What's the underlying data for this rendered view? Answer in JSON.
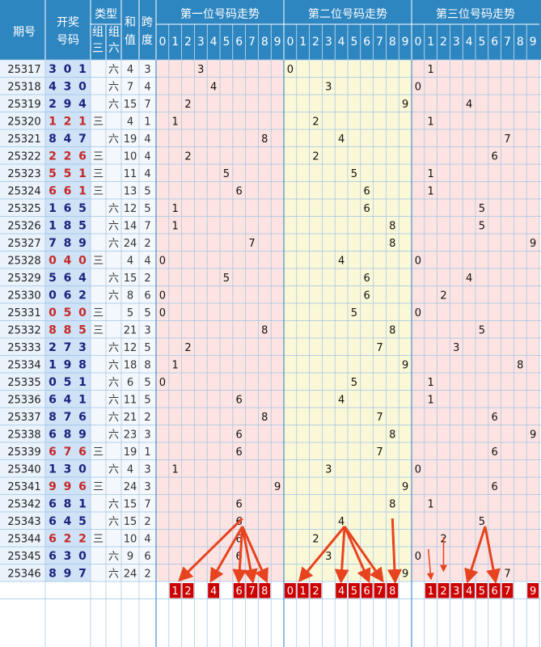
{
  "header": {
    "period_label": "期号",
    "draw_label_1": "开奖",
    "draw_label_2": "号码",
    "type_label": "类型",
    "group3_label_1": "组",
    "group3_label_2": "三",
    "group6_label_1": "组",
    "group6_label_2": "六",
    "sum_label_1": "和",
    "sum_label_2": "值",
    "span_label_1": "跨",
    "span_label_2": "度",
    "pos1_title": "第一位号码走势",
    "pos2_title": "第二位号码走势",
    "pos3_title": "第三位号码走势",
    "digits": [
      "0",
      "1",
      "2",
      "3",
      "4",
      "5",
      "6",
      "7",
      "8",
      "9"
    ],
    "group3_mark": "三",
    "group6_mark": "六"
  },
  "chart_data": {
    "type": "table",
    "rows": [
      {
        "period": "25317",
        "digits": [
          3,
          0,
          1
        ],
        "type": "六",
        "sum": 4,
        "span": 3
      },
      {
        "period": "25318",
        "digits": [
          4,
          3,
          0
        ],
        "type": "六",
        "sum": 7,
        "span": 4
      },
      {
        "period": "25319",
        "digits": [
          2,
          9,
          4
        ],
        "type": "六",
        "sum": 15,
        "span": 7
      },
      {
        "period": "25320",
        "digits": [
          1,
          2,
          1
        ],
        "type": "三",
        "sum": 4,
        "span": 1
      },
      {
        "period": "25321",
        "digits": [
          8,
          4,
          7
        ],
        "type": "六",
        "sum": 19,
        "span": 4
      },
      {
        "period": "25322",
        "digits": [
          2,
          2,
          6
        ],
        "type": "三",
        "sum": 10,
        "span": 4
      },
      {
        "period": "25323",
        "digits": [
          5,
          5,
          1
        ],
        "type": "三",
        "sum": 11,
        "span": 4
      },
      {
        "period": "25324",
        "digits": [
          6,
          6,
          1
        ],
        "type": "三",
        "sum": 13,
        "span": 5
      },
      {
        "period": "25325",
        "digits": [
          1,
          6,
          5
        ],
        "type": "六",
        "sum": 12,
        "span": 5
      },
      {
        "period": "25326",
        "digits": [
          1,
          8,
          5
        ],
        "type": "六",
        "sum": 14,
        "span": 7
      },
      {
        "period": "25327",
        "digits": [
          7,
          8,
          9
        ],
        "type": "六",
        "sum": 24,
        "span": 2
      },
      {
        "period": "25328",
        "digits": [
          0,
          4,
          0
        ],
        "type": "三",
        "sum": 4,
        "span": 4
      },
      {
        "period": "25329",
        "digits": [
          5,
          6,
          4
        ],
        "type": "六",
        "sum": 15,
        "span": 2
      },
      {
        "period": "25330",
        "digits": [
          0,
          6,
          2
        ],
        "type": "六",
        "sum": 8,
        "span": 6
      },
      {
        "period": "25331",
        "digits": [
          0,
          5,
          0
        ],
        "type": "三",
        "sum": 5,
        "span": 5
      },
      {
        "period": "25332",
        "digits": [
          8,
          8,
          5
        ],
        "type": "三",
        "sum": 21,
        "span": 3
      },
      {
        "period": "25333",
        "digits": [
          2,
          7,
          3
        ],
        "type": "六",
        "sum": 12,
        "span": 5
      },
      {
        "period": "25334",
        "digits": [
          1,
          9,
          8
        ],
        "type": "六",
        "sum": 18,
        "span": 8
      },
      {
        "period": "25335",
        "digits": [
          0,
          5,
          1
        ],
        "type": "六",
        "sum": 6,
        "span": 5
      },
      {
        "period": "25336",
        "digits": [
          6,
          4,
          1
        ],
        "type": "六",
        "sum": 11,
        "span": 5
      },
      {
        "period": "25337",
        "digits": [
          8,
          7,
          6
        ],
        "type": "六",
        "sum": 21,
        "span": 2
      },
      {
        "period": "25338",
        "digits": [
          6,
          8,
          9
        ],
        "type": "六",
        "sum": 23,
        "span": 3
      },
      {
        "period": "25339",
        "digits": [
          6,
          7,
          6
        ],
        "type": "三",
        "sum": 19,
        "span": 1
      },
      {
        "period": "25340",
        "digits": [
          1,
          3,
          0
        ],
        "type": "六",
        "sum": 4,
        "span": 3
      },
      {
        "period": "25341",
        "digits": [
          9,
          9,
          6
        ],
        "type": "三",
        "sum": 24,
        "span": 3
      },
      {
        "period": "25342",
        "digits": [
          6,
          8,
          1
        ],
        "type": "六",
        "sum": 15,
        "span": 7
      },
      {
        "period": "25343",
        "digits": [
          6,
          4,
          5
        ],
        "type": "六",
        "sum": 15,
        "span": 2
      },
      {
        "period": "25344",
        "digits": [
          6,
          2,
          2
        ],
        "type": "三",
        "sum": 10,
        "span": 4
      },
      {
        "period": "25345",
        "digits": [
          6,
          3,
          0
        ],
        "type": "六",
        "sum": 9,
        "span": 6
      },
      {
        "period": "25346",
        "digits": [
          8,
          9,
          7
        ],
        "type": "六",
        "sum": 24,
        "span": 2
      }
    ],
    "predictions": {
      "pos1": [
        1,
        2,
        4,
        6,
        7,
        8
      ],
      "pos2": [
        0,
        1,
        2,
        4,
        5,
        6,
        7,
        8
      ],
      "pos3": [
        1,
        2,
        3,
        4,
        5,
        6,
        7,
        9
      ]
    }
  },
  "colors": {
    "header_bg": "#2e86c1",
    "period_bg": "#eaf3fb",
    "draw_bg": "#cfe2f6",
    "digit_blue": "#1a237e",
    "digit_red": "#c62828",
    "pos1_bg": "#fde4e2",
    "pos2_bg": "#fbf8d8",
    "pos3_bg": "#fde4e2",
    "grid": "#9cc3e6",
    "pred_bg": "#cc0000",
    "arrow": "#e8431f"
  }
}
